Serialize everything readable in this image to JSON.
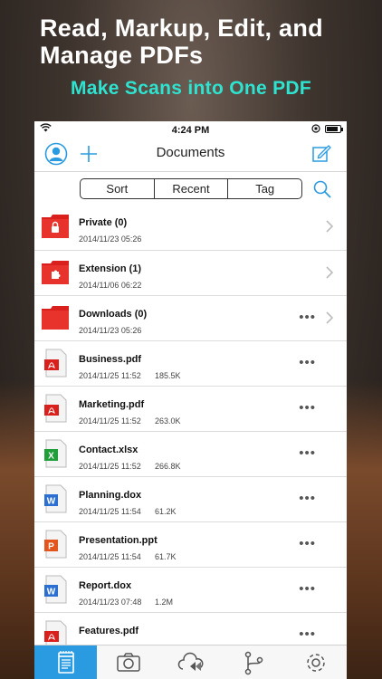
{
  "promo": {
    "headline": "Read, Markup, Edit, and Manage PDFs",
    "subline": "Make Scans into One PDF"
  },
  "status_bar": {
    "time": "4:24 PM"
  },
  "nav": {
    "title": "Documents"
  },
  "segments": [
    "Sort",
    "Recent",
    "Tag"
  ],
  "items": [
    {
      "name": "Private (0)",
      "date": "2014/11/23 05:26",
      "size": "",
      "type": "folder-lock",
      "more": false,
      "chevron": true
    },
    {
      "name": "Extension (1)",
      "date": "2014/11/06 06:22",
      "size": "",
      "type": "folder-puzzle",
      "more": false,
      "chevron": true
    },
    {
      "name": "Downloads (0)",
      "date": "2014/11/23 05:26",
      "size": "",
      "type": "folder",
      "more": true,
      "chevron": true
    },
    {
      "name": "Business.pdf",
      "date": "2014/11/25 11:52",
      "size": "185.5K",
      "type": "pdf",
      "more": true,
      "chevron": false
    },
    {
      "name": "Marketing.pdf",
      "date": "2014/11/25 11:52",
      "size": "263.0K",
      "type": "pdf",
      "more": true,
      "chevron": false
    },
    {
      "name": "Contact.xlsx",
      "date": "2014/11/25 11:52",
      "size": "266.8K",
      "type": "xlsx",
      "more": true,
      "chevron": false
    },
    {
      "name": "Planning.dox",
      "date": "2014/11/25 11:54",
      "size": "61.2K",
      "type": "doc",
      "more": true,
      "chevron": false
    },
    {
      "name": "Presentation.ppt",
      "date": "2014/11/25 11:54",
      "size": "61.7K",
      "type": "ppt",
      "more": true,
      "chevron": false
    },
    {
      "name": "Report.dox",
      "date": "2014/11/23 07:48",
      "size": "1.2M",
      "type": "doc",
      "more": true,
      "chevron": false
    },
    {
      "name": "Features.pdf",
      "date": "",
      "size": "",
      "type": "pdf",
      "more": true,
      "chevron": false
    }
  ],
  "more_glyph": "•••",
  "tabs": [
    {
      "icon": "documents-icon",
      "active": true
    },
    {
      "icon": "camera-icon",
      "active": false
    },
    {
      "icon": "cloud-transfer-icon",
      "active": false
    },
    {
      "icon": "branch-icon",
      "active": false
    },
    {
      "icon": "gear-icon",
      "active": false
    }
  ],
  "colors": {
    "accent": "#2a9be0",
    "headline_sub": "#2ee3d0",
    "folder_red": "#d9201c"
  }
}
